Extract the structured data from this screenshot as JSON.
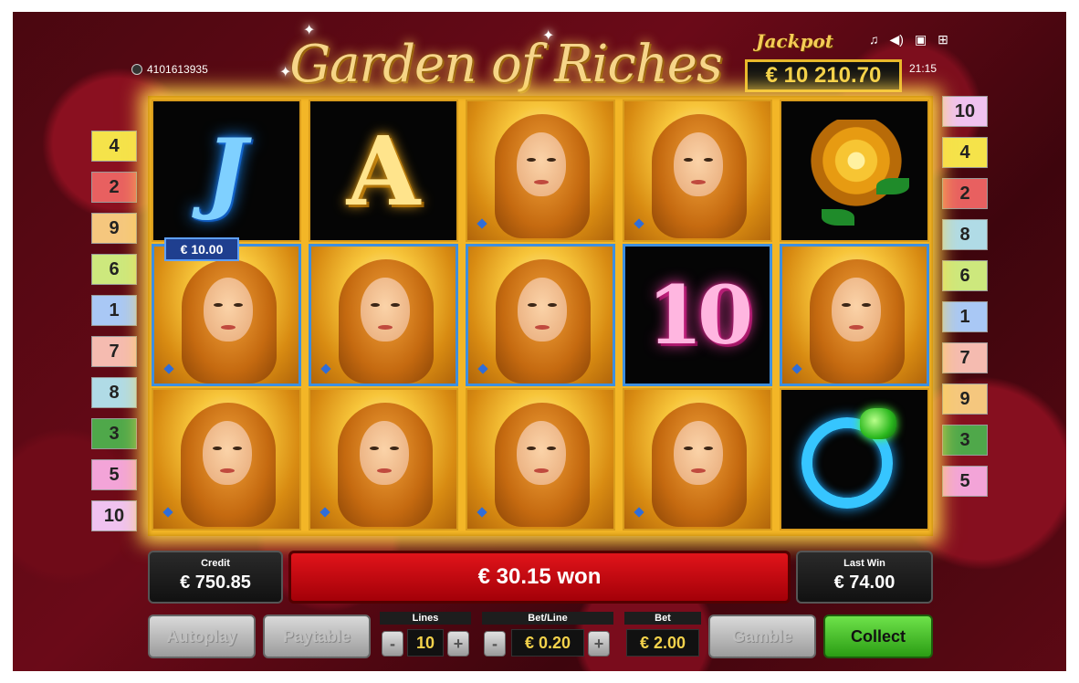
{
  "header": {
    "title": "Garden of Riches",
    "jackpot_label": "Jackpot",
    "jackpot_value": "€ 10 210.70",
    "ticket_id": "4101613935",
    "clock": "21:15",
    "icons": [
      "music-icon",
      "sound-icon",
      "fullscreen-icon",
      "menu-icon"
    ]
  },
  "reels": [
    [
      "J",
      "girl",
      "girl"
    ],
    [
      "A",
      "girl",
      "girl"
    ],
    [
      "girl",
      "girl",
      "girl"
    ],
    [
      "girl",
      "10",
      "girl"
    ],
    [
      "rose",
      "girl",
      "ring"
    ]
  ],
  "win_line_label": "€ 10.00",
  "winning_line": 1,
  "paylines_left": [
    "4",
    "2",
    "9",
    "6",
    "1",
    "7",
    "8",
    "3",
    "5",
    "10"
  ],
  "paylines_right": [
    "10",
    "4",
    "2",
    "8",
    "6",
    "1",
    "7",
    "9",
    "3",
    "5"
  ],
  "payline_colors": {
    "1": "#a9c8f5",
    "2": "#e86060",
    "3": "#4fa84a",
    "4": "#f5e34a",
    "5": "#f3a4d8",
    "6": "#cde87d",
    "7": "#f5bbb0",
    "8": "#b0dbe6",
    "9": "#f5c77e",
    "10": "#f0c2f0"
  },
  "panels": {
    "credit_label": "Credit",
    "credit_value": "€ 750.85",
    "win_message": "€ 30.15 won",
    "last_win_label": "Last Win",
    "last_win_value": "€ 74.00"
  },
  "controls": {
    "autoplay": "Autoplay",
    "paytable": "Paytable",
    "lines_label": "Lines",
    "lines_value": "10",
    "betline_label": "Bet/Line",
    "betline_value": "€ 0.20",
    "bet_label": "Bet",
    "bet_value": "€ 2.00",
    "gamble": "Gamble",
    "collect": "Collect",
    "minus": "-",
    "plus": "+"
  }
}
